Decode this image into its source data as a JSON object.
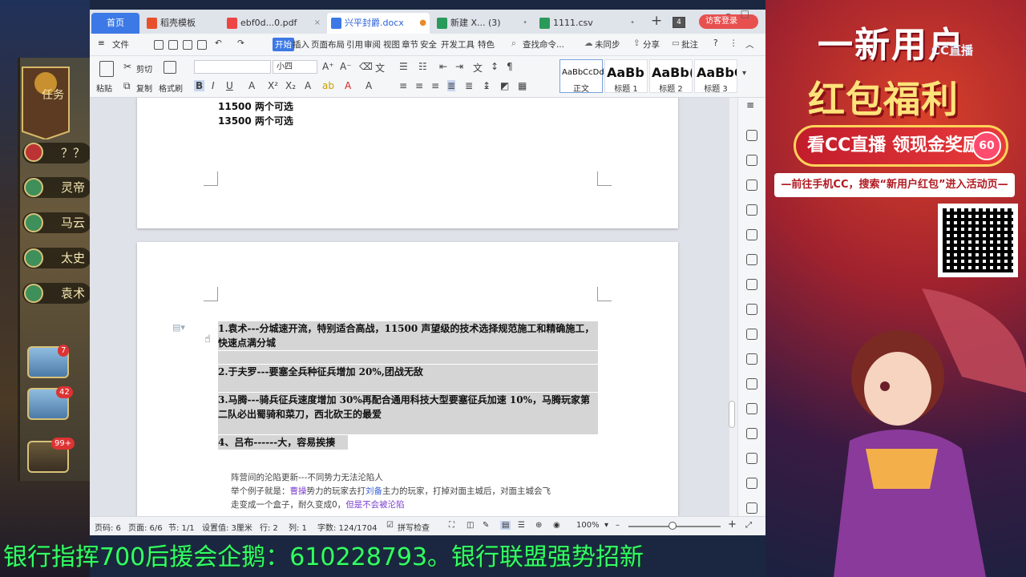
{
  "tabs": [
    {
      "label": "首页"
    },
    {
      "label": "稻壳模板"
    },
    {
      "label": "ebf0d...0.pdf"
    },
    {
      "label": "兴平封爵.docx"
    },
    {
      "label": "新建 X... (3)"
    },
    {
      "label": "1111.csv"
    }
  ],
  "tab_count": "4",
  "login_label": "访客登录",
  "menu": {
    "file": "文件",
    "items": [
      "开始",
      "插入",
      "页面布局",
      "引用",
      "审阅",
      "视图",
      "章节",
      "安全",
      "开发工具",
      "特色"
    ],
    "search": "查找命令...",
    "sync": "未同步",
    "share": "分享",
    "annotate": "批注"
  },
  "ribbon": {
    "paste": "粘贴",
    "cut": "剪切",
    "copy": "复制",
    "format_painter": "格式刷",
    "font_name": "",
    "font_size": "小四",
    "styles": [
      {
        "sample": "AaBbCcDd",
        "name": "正文"
      },
      {
        "sample": "AaBb",
        "name": "标题 1"
      },
      {
        "sample": "AaBb(",
        "name": "标题 2"
      },
      {
        "sample": "AaBbC",
        "name": "标题 3"
      }
    ]
  },
  "document": {
    "page1_lines": [
      "11500 两个可选",
      "13500  两个可选"
    ],
    "items": [
      "1.袁术---分城速开流，特别适合高战，11500 声望级的技术选择规范施工和精确施工，快速点满分城",
      "2.于夫罗---要塞全兵种征兵增加 20%,团战无敌",
      "3.马腾---骑兵征兵速度增加 30%再配合通用科技大型要塞征兵加速 10%，马腾玩家第二队必出蜀骑和菜刀，西北砍王的最爱",
      "4、吕布------大，容易挨揍"
    ],
    "note_title": "阵营间的沦陷更新---不同势力无法沦陷人",
    "note_line2_a": "举个例子就是：",
    "note_line2_b": "曹操",
    "note_line2_c": "势力的玩家去打",
    "note_line2_d": "刘备",
    "note_line2_e": "主力的玩家，打掉对面主城后，对面主城会飞",
    "note_line3_a": "走变成一个盒子，耐久变成0，",
    "note_line3_b": "但是不会被沦陷"
  },
  "status": {
    "page_no": "页码: 6",
    "pages": "页面: 6/6",
    "section": "节: 1/1",
    "setting": "设置值: 3厘米",
    "row": "行: 2",
    "col": "列: 1",
    "words": "字数: 124/1704",
    "spell": "拼写检查",
    "zoom": "100%"
  },
  "game": {
    "banner": "任务",
    "rows": [
      "？？",
      "灵帝",
      "马云",
      "太史",
      "袁术"
    ],
    "badge_mail": "7",
    "badge_book": "42",
    "badge_chat": "99+"
  },
  "promo": {
    "title": "一新用户",
    "cc": "CC直播",
    "sub": "红包福利",
    "cash": "看CC直播 领现金奖励",
    "cash_amount": "60",
    "strip": "—前往手机CC，搜索“新用户红包”进入活动页—"
  },
  "ticker": "银行指挥700后援会企鹅：610228793。银行联盟强势招新",
  "colors": {
    "accent": "#3d79e6",
    "highlight": "#d5d5d5",
    "ticker": "#33ff66",
    "purple": "#7b3fd0"
  }
}
